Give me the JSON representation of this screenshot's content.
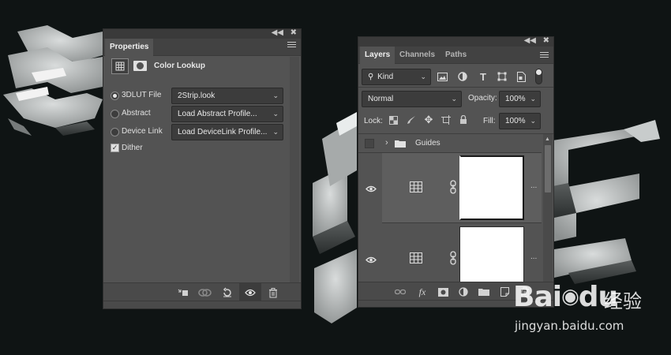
{
  "properties_panel": {
    "tab_label": "Properties",
    "adjustment_title": "Color Lookup",
    "rows": [
      {
        "label": "3DLUT File",
        "value": "2Strip.look",
        "selected": true
      },
      {
        "label": "Abstract",
        "value": "Load Abstract Profile...",
        "selected": false
      },
      {
        "label": "Device Link",
        "value": "Load DeviceLink Profile...",
        "selected": false
      }
    ],
    "dither_label": "Dither",
    "dither_checked": true
  },
  "layers_panel": {
    "tabs": [
      "Layers",
      "Channels",
      "Paths"
    ],
    "filter_kind": "Kind",
    "blend_mode": "Normal",
    "opacity_label": "Opacity:",
    "opacity_value": "100%",
    "lock_label": "Lock:",
    "fill_label": "Fill:",
    "fill_value": "100%",
    "group_name": "Guides",
    "more_glyph": "..."
  },
  "watermark": {
    "brand": "Bai",
    "brand_end": "du",
    "cn_text": "经验",
    "url": "jingyan.baidu.com"
  },
  "colors": {
    "panel": "#535353",
    "panel_dark": "#424242",
    "field": "#3c3c3c",
    "background": "#0f1414"
  }
}
